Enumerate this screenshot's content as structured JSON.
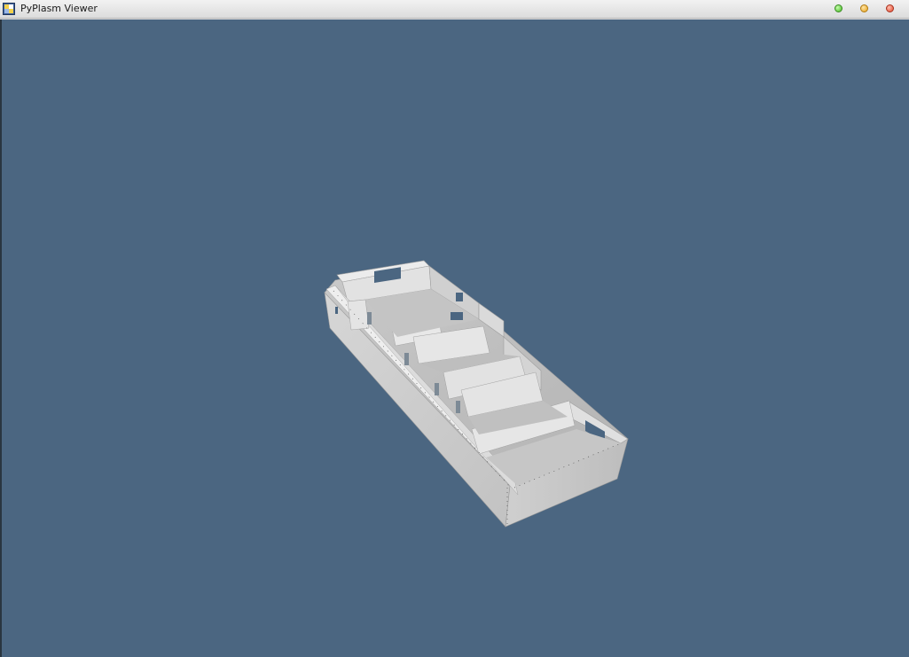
{
  "window": {
    "title": "PyPlasm Viewer",
    "icon": "pyplasm-app-icon",
    "controls": {
      "maximize": {
        "icon": "maximize-icon",
        "color": "#3fb81c"
      },
      "minimize": {
        "icon": "minimize-icon",
        "color": "#e6a21b"
      },
      "close": {
        "icon": "close-icon",
        "color": "#e2452a"
      }
    }
  },
  "viewport": {
    "background": "#4b6681",
    "model": "building-floorplan-3d-model",
    "model_color": "#d8d8d8"
  }
}
